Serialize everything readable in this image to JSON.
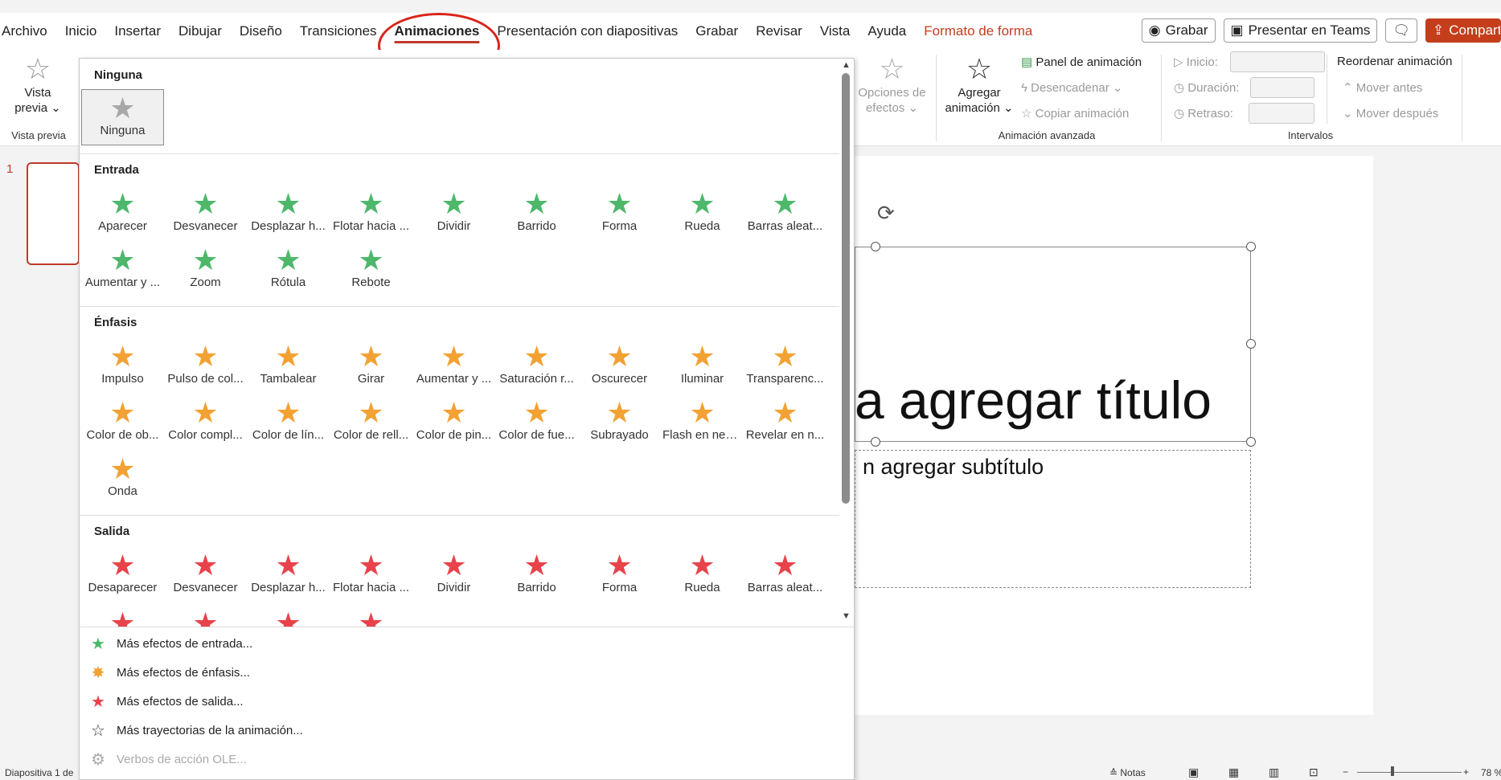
{
  "tabs": [
    "Archivo",
    "Inicio",
    "Insertar",
    "Dibujar",
    "Diseño",
    "Transiciones",
    "Animaciones",
    "Presentación con diapositivas",
    "Grabar",
    "Revisar",
    "Vista",
    "Ayuda",
    "Formato de forma"
  ],
  "active_tab": "Animaciones",
  "top_buttons": {
    "grabar": "Grabar",
    "teams": "Presentar en Teams",
    "share": "Compartir"
  },
  "ribbon": {
    "preview_label_1": "Vista",
    "preview_label_2": "previa",
    "preview_group": "Vista previa",
    "effect_options_1": "Opciones de",
    "effect_options_2": "efectos",
    "add_anim_1": "Agregar",
    "add_anim_2": "animación",
    "panel": "Panel de animación",
    "trigger": "Desencadenar",
    "copy": "Copiar animación",
    "advanced_group": "Animación avanzada",
    "start": "Inicio:",
    "duration": "Duración:",
    "delay": "Retraso:",
    "timing_group": "Intervalos",
    "reorder": "Reordenar animación",
    "move_earlier": "Mover antes",
    "move_later": "Mover después"
  },
  "gallery": {
    "none_section": "Ninguna",
    "none_item": "Ninguna",
    "entrance_section": "Entrada",
    "entrance": [
      "Aparecer",
      "Desvanecer",
      "Desplazar h...",
      "Flotar hacia ...",
      "Dividir",
      "Barrido",
      "Forma",
      "Rueda",
      "Barras aleat...",
      "Aumentar y ...",
      "Zoom",
      "Rótula",
      "Rebote"
    ],
    "emphasis_section": "Énfasis",
    "emphasis": [
      "Impulso",
      "Pulso de col...",
      "Tambalear",
      "Girar",
      "Aumentar y ...",
      "Saturación r...",
      "Oscurecer",
      "Iluminar",
      "Transparenc...",
      "Color de ob...",
      "Color compl...",
      "Color de lín...",
      "Color de rell...",
      "Color de pin...",
      "Color de fue...",
      "Subrayado",
      "Flash en neg...",
      "Revelar en n...",
      "Onda"
    ],
    "exit_section": "Salida",
    "exit": [
      "Desaparecer",
      "Desvanecer",
      "Desplazar h...",
      "Flotar hacia ...",
      "Dividir",
      "Barrido",
      "Forma",
      "Rueda",
      "Barras aleat..."
    ],
    "more_entrance": "Más efectos de entrada...",
    "more_emphasis": "Más efectos de énfasis...",
    "more_exit": "Más efectos de salida...",
    "more_paths": "Más trayectorias de la animación...",
    "ole_verbs": "Verbos de acción OLE..."
  },
  "thumbnail_number": "1",
  "slide": {
    "title": "a agregar título",
    "subtitle": "n agregar subtítulo"
  },
  "status": {
    "slide": "Diapositiva 1 de",
    "notes": "Notas",
    "zoom": "78 %"
  },
  "colors": {
    "accent": "#c43e1c",
    "entrance": "#4db86a",
    "emphasis": "#f2a233",
    "exit": "#e8434b"
  }
}
